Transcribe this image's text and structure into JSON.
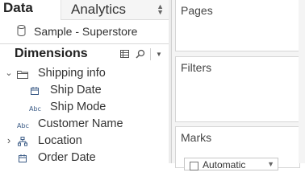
{
  "tabs": {
    "data_label": "Data",
    "analytics_label": "Analytics"
  },
  "datasource": {
    "name": "Sample - Superstore",
    "icon": "database-icon"
  },
  "dimensions": {
    "title": "Dimensions",
    "items": [
      {
        "label": "Shipping info",
        "kind": "folder",
        "expanded": true
      },
      {
        "label": "Ship Date",
        "kind": "date"
      },
      {
        "label": "Ship Mode",
        "kind": "string",
        "type_label": "Abc"
      },
      {
        "label": "Customer Name",
        "kind": "string",
        "type_label": "Abc"
      },
      {
        "label": "Location",
        "kind": "hierarchy",
        "expanded": false
      },
      {
        "label": "Order Date",
        "kind": "date"
      }
    ]
  },
  "shelves": {
    "pages": "Pages",
    "filters": "Filters",
    "marks": "Marks",
    "marks_type": "Automatic"
  },
  "colors": {
    "field_icon_blue": "#3b5b86",
    "shelf_bg": "#f4f4f4",
    "border": "#d6d6d6"
  }
}
